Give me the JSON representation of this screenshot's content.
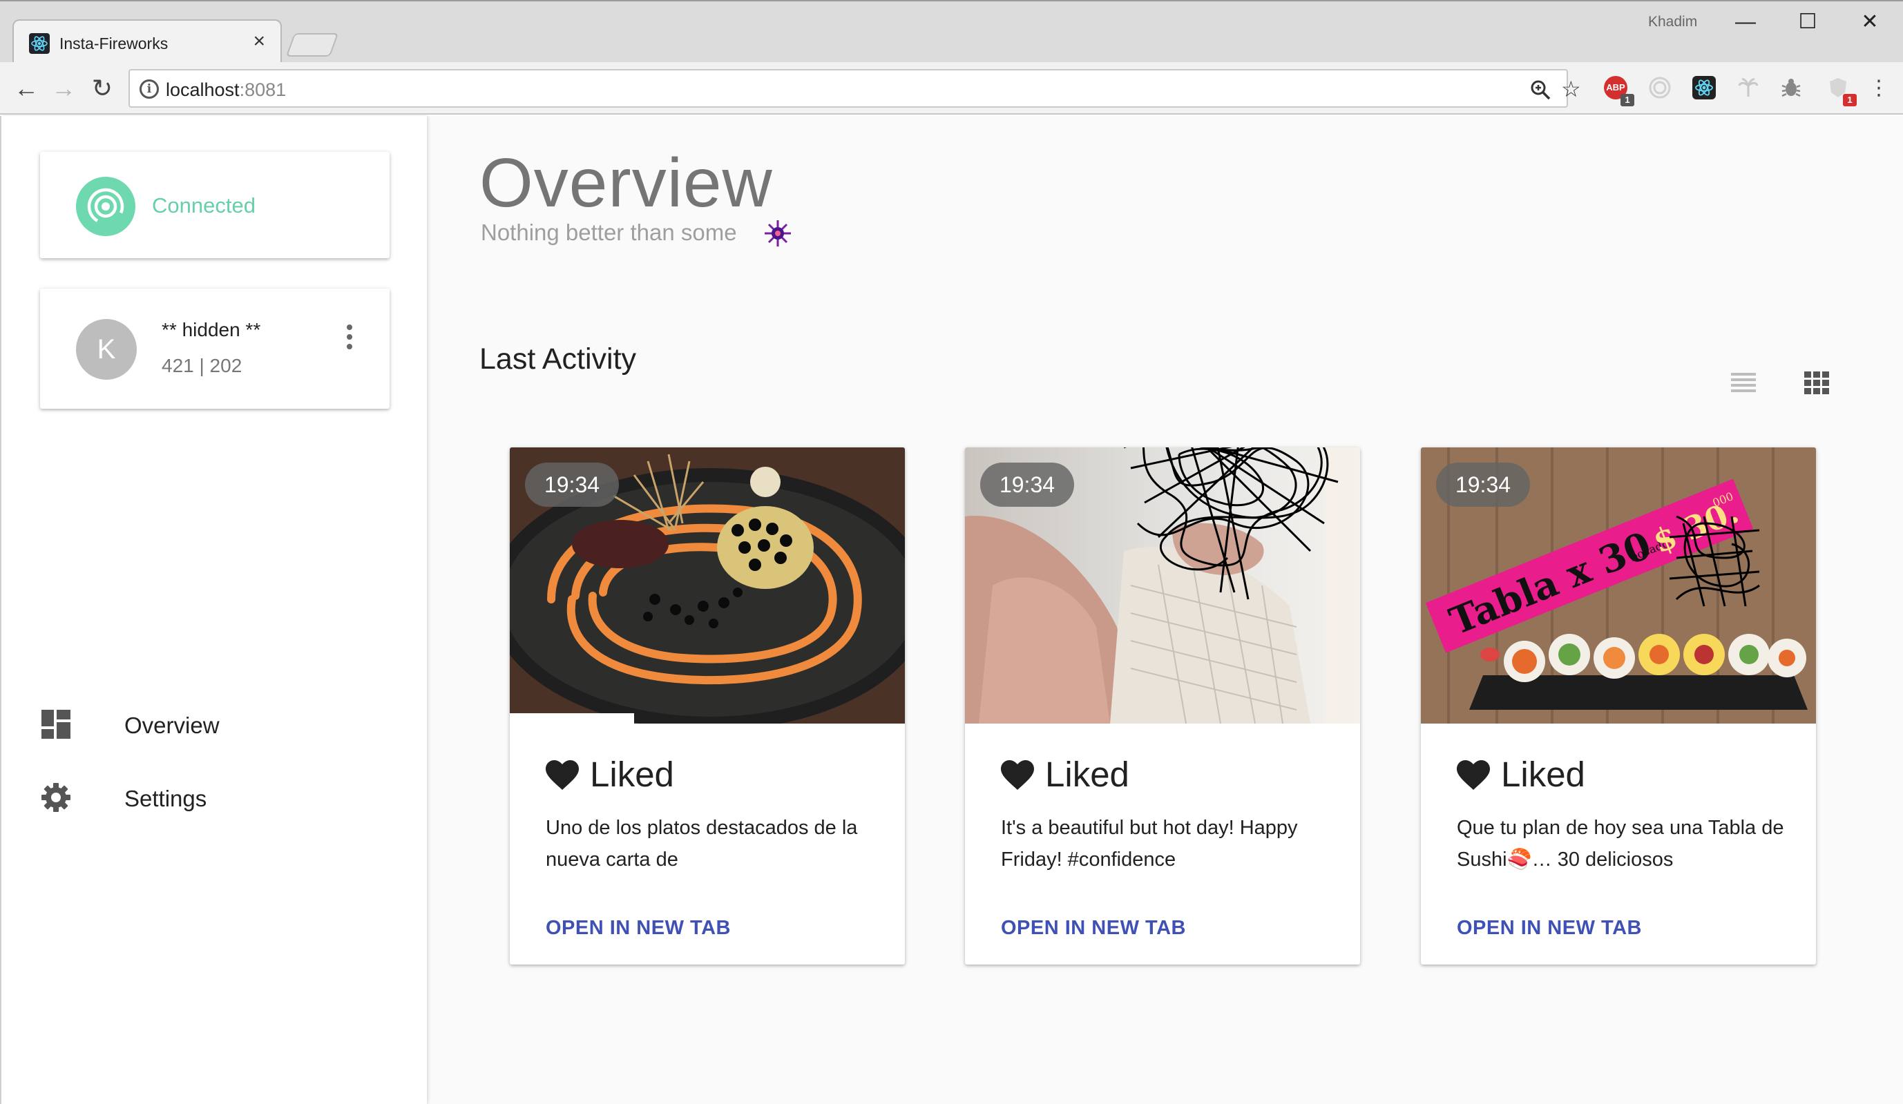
{
  "browser": {
    "tab_title": "Insta-Fireworks",
    "tab_close": "×",
    "user": "Khadim",
    "url_host": "localhost",
    "url_port": ":8081",
    "window_buttons": {
      "minimize": "—",
      "maximize": "☐",
      "close": "✕"
    },
    "extensions": [
      {
        "name": "adblock-icon",
        "label": "ABP",
        "badge": "1",
        "color": "#d32f2f"
      },
      {
        "name": "extension-target-icon",
        "label": "",
        "badge": "",
        "color": "#e0e0e0"
      },
      {
        "name": "react-devtools-icon",
        "label": "",
        "badge": "",
        "color": "#222222"
      },
      {
        "name": "extension-palm-icon",
        "label": "",
        "badge": "",
        "color": "#e0e0e0"
      },
      {
        "name": "extension-bug-icon",
        "label": "",
        "badge": "",
        "color": "#e0e0e0"
      },
      {
        "name": "extension-shield-icon",
        "label": "",
        "badge": "1",
        "color": "#e0e0e0"
      }
    ]
  },
  "sidebar": {
    "connection": {
      "status": "Connected",
      "color": "#6ed8ae"
    },
    "account": {
      "avatar_letter": "K",
      "name": "** hidden **",
      "stats": "421 | 202"
    },
    "nav": [
      {
        "label": "Overview",
        "icon": "dashboard-icon"
      },
      {
        "label": "Settings",
        "icon": "gear-icon"
      }
    ]
  },
  "main": {
    "title": "Overview",
    "subtitle": "Nothing better than some",
    "section_title": "Last Activity",
    "view_modes": [
      "list-view-icon",
      "grid-view-icon"
    ],
    "activity": [
      {
        "time": "19:34",
        "action": "Liked",
        "caption": "Uno de los platos destacados de la nueva carta de",
        "link": "OPEN IN NEW TAB"
      },
      {
        "time": "19:34",
        "action": "Liked",
        "caption": "It's a beautiful but hot day! Happy Friday! #confidence",
        "link": "OPEN IN NEW TAB"
      },
      {
        "time": "19:34",
        "action": "Liked",
        "caption": "Que tu plan de hoy sea una Tabla de Sushi🍣… 30 deliciosos",
        "link": "OPEN IN NEW TAB"
      }
    ]
  },
  "colors": {
    "accent_link": "#3f51b5",
    "connected": "#6ed8ae",
    "promo_pink": "#e91e8c"
  },
  "image_text": {
    "promo_headline": "Tabla x 30",
    "promo_small": "bocados",
    "promo_price": "$ 30.",
    "promo_cents": "000"
  }
}
